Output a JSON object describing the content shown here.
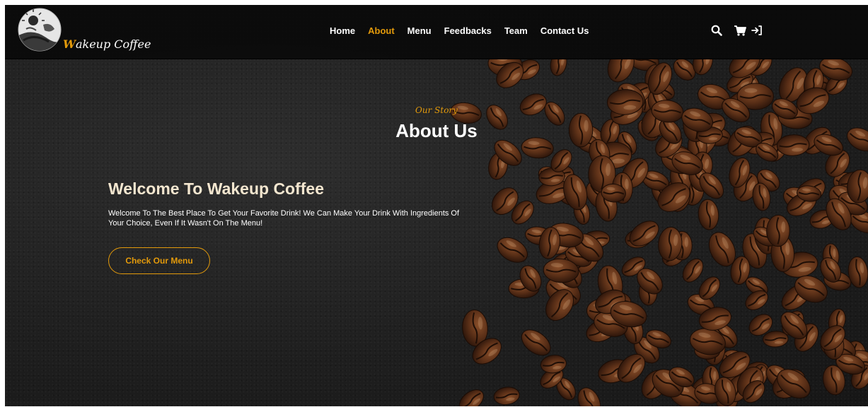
{
  "brand": {
    "logo_text_first": "W",
    "logo_text_rest": "akeup Coffee",
    "accent": "#e39a0b"
  },
  "nav": {
    "items": [
      {
        "label": "Home",
        "active": false
      },
      {
        "label": "About",
        "active": true
      },
      {
        "label": "Menu",
        "active": false
      },
      {
        "label": "Feedbacks",
        "active": false
      },
      {
        "label": "Team",
        "active": false
      },
      {
        "label": "Contact Us",
        "active": false
      }
    ]
  },
  "header_icons": [
    "search-icon",
    "cart-icon",
    "login-icon"
  ],
  "hero": {
    "subtitle": "Our Story",
    "title": "About Us",
    "welcome_heading": "Welcome To Wakeup Coffee",
    "description": "Welcome To The Best Place To Get Your Favorite Drink! We Can Make Your Drink With Ingredients Of Your Choice, Even If It Wasn't On The Menu!",
    "cta_label": "Check Our Menu"
  }
}
